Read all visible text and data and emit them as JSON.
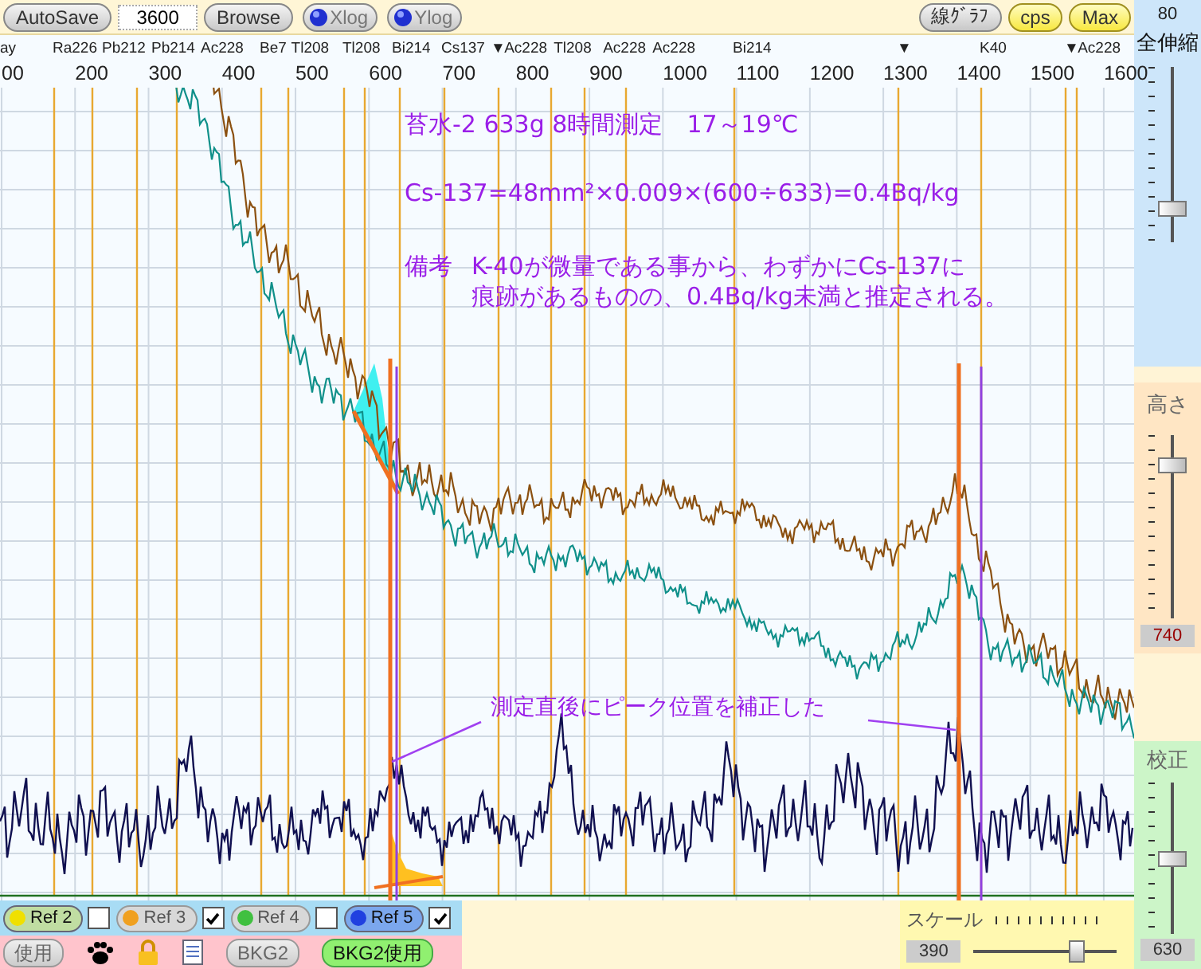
{
  "toolbar": {
    "autosave": "AutoSave",
    "count_field": {
      "value": "3600"
    },
    "browse": "Browse",
    "toggles": [
      {
        "label": "Xlog",
        "on": false
      },
      {
        "label": "Ylog",
        "on": false
      }
    ],
    "right_buttons": [
      {
        "label": "線ｸﾞﾗﾌ",
        "on": false
      },
      {
        "label": "cps",
        "on": true
      },
      {
        "label": "Max",
        "on": true
      }
    ]
  },
  "nuclides": [
    "ay",
    "Ra226",
    "Pb212",
    "Pb214",
    "Ac228",
    "Be7",
    "Tl208",
    "Tl208",
    "Bi214",
    "Cs137",
    "▼",
    "Ac228",
    "Tl208",
    "Ac228",
    "Ac228",
    "Bi214",
    "▼",
    "K40",
    "▼",
    "Ac228"
  ],
  "energy_axis": [
    "00",
    "200",
    "300",
    "400",
    "500",
    "600",
    "700",
    "800",
    "900",
    "1000",
    "1100",
    "1200",
    "1300",
    "1400",
    "1500",
    "1600"
  ],
  "annotations": {
    "title": "苔水-2 633g 8時間測定　17～19℃",
    "formula": "Cs-137=48mm²×0.009×(600÷633)=0.4Bq/kg",
    "note": {
      "label": "備考",
      "lines": [
        "K-40が微量である事から、わずかにCs-137に",
        "痕跡があるものの、0.4Bq/kg未満と推定される。"
      ]
    },
    "callout": "測定直後にピーク位置を補正した"
  },
  "refs": [
    {
      "label": "Ref 2",
      "color": "#f0e000",
      "selected": true,
      "checked": false
    },
    {
      "label": "Ref 3",
      "color": "#f0a020",
      "selected": false,
      "checked": true
    },
    {
      "label": "Ref 4",
      "color": "#40c040",
      "selected": false,
      "checked": false
    },
    {
      "label": "Ref 5",
      "color": "#2040e0",
      "selected": true,
      "checked": true
    }
  ],
  "bottom_buttons": [
    {
      "label": "使用",
      "on": false
    },
    {
      "label": "BKG2",
      "on": false
    },
    {
      "label": "BKG2使用",
      "on": true
    }
  ],
  "scale": {
    "label": "スケール",
    "value": "390",
    "level": 0.75
  },
  "right_panel": {
    "top_value": "80",
    "zoom": {
      "label": "全伸縮",
      "level": 0.16
    },
    "height": {
      "label": "高さ",
      "level": 0.87,
      "value": "740"
    },
    "calibration": {
      "label": "校正",
      "level": 0.5,
      "value": "630"
    }
  }
}
